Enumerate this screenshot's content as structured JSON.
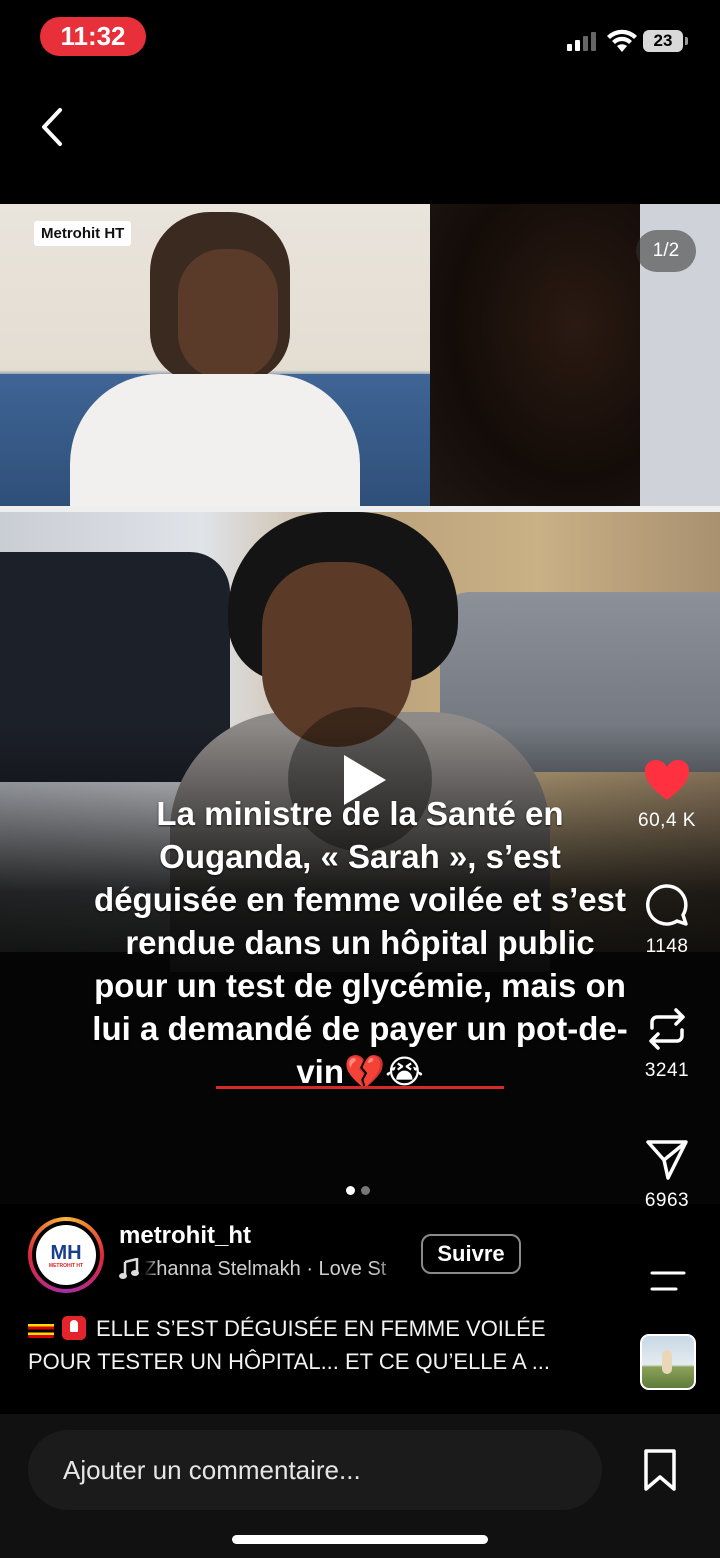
{
  "status_bar": {
    "time": "11:32",
    "battery": "23"
  },
  "post": {
    "watermark": "Metrohit HT",
    "page_indicator": "1/2",
    "caption_lines": [
      "La ministre de la Santé en",
      "Ouganda, « Sarah », s’est",
      "déguisée en femme voilée et s’est",
      "rendue dans un hôpital public",
      "pour un test de glycémie, mais on",
      "lui a demandé de payer un pot-de-",
      "vin💔😭"
    ],
    "carousel": {
      "total": 2,
      "current": 1
    }
  },
  "actions": {
    "likes": "60,4 K",
    "comments": "1148",
    "reposts": "3241",
    "shares": "6963"
  },
  "author": {
    "username": "metrohit_ht",
    "avatar_text": "MH",
    "avatar_subtext": "METROHIT HT",
    "audio": "Zhanna Stelmakh · Love St",
    "follow_label": "Suivre"
  },
  "description": {
    "line1": "ELLE S’EST DÉGUISÉE EN FEMME VOILÉE",
    "line2": "POUR TESTER UN HÔPITAL... ET CE QU’ELLE A ..."
  },
  "comment_bar": {
    "placeholder": "Ajouter un commentaire..."
  },
  "colors": {
    "time_pill": "#e8303a",
    "like_heart": "#ff3040",
    "caption_underline": "#d52a2a"
  },
  "icons": [
    "back-chevron-icon",
    "play-icon",
    "heart-icon",
    "comment-icon",
    "repost-icon",
    "share-icon",
    "menu-icon",
    "music-note-icon",
    "bookmark-icon"
  ]
}
